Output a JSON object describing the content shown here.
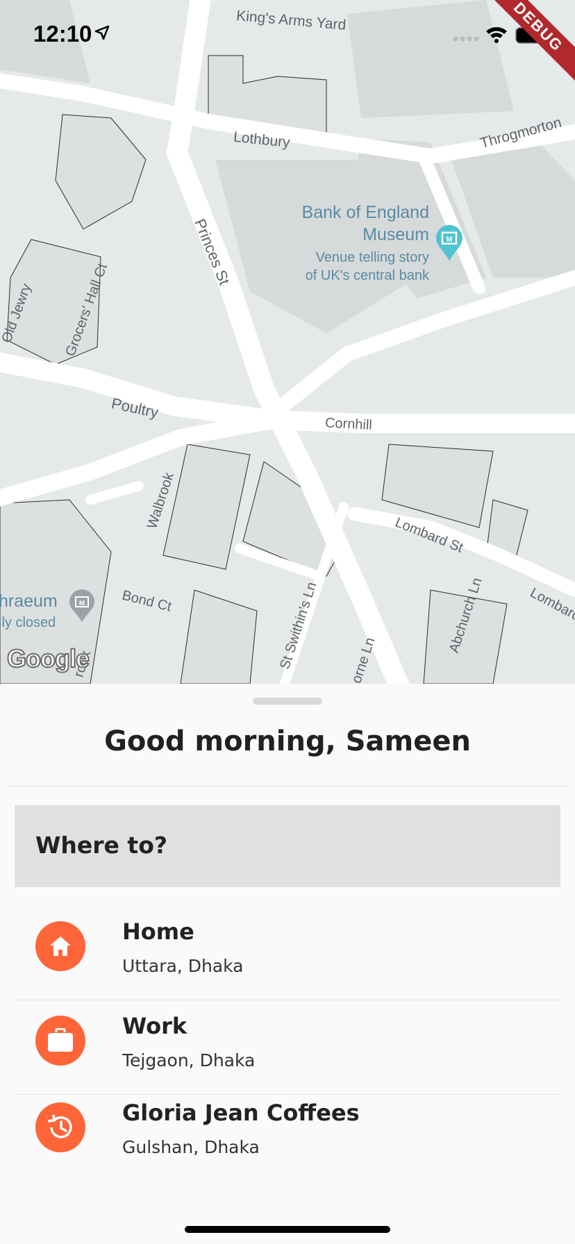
{
  "status_bar": {
    "time": "12:10",
    "debug_label": "DEBUG"
  },
  "map": {
    "street_labels": {
      "kings_arms_yard": "King's Arms Yard",
      "lothbury": "Lothbury",
      "throgmorton": "Throgmorton",
      "princes_st": "Princes St",
      "old_jewry": "Old Jewry",
      "grocers_hall_ct": "Grocers' Hall Ct",
      "poultry": "Poultry",
      "cornhill": "Cornhill",
      "walbrook": "Walbrook",
      "lombard_st": "Lombard St",
      "lombard": "Lombard",
      "bond_ct": "Bond Ct",
      "st_swithins_ln": "St Swithin's Ln",
      "abchurch_ln": "Abchurch Ln",
      "orne_ln": "orne Ln",
      "rook": "rook"
    },
    "poi": {
      "name_line1": "Bank of England",
      "name_line2": "Museum",
      "desc_line1": "Venue telling story",
      "desc_line2": "of UK's central bank",
      "icon": "museum-icon",
      "color": "#4fc3d0"
    },
    "poi2": {
      "name": "hraeum",
      "desc": "ily closed",
      "icon": "museum-icon"
    },
    "attribution": "Google"
  },
  "sheet": {
    "greeting": "Good morning, Sameen",
    "search_label": "Where to?",
    "accent": "#fe6538",
    "places": [
      {
        "title": "Home",
        "subtitle": "Uttara, Dhaka",
        "icon": "home-icon"
      },
      {
        "title": "Work",
        "subtitle": "Tejgaon, Dhaka",
        "icon": "briefcase-icon"
      },
      {
        "title": "Gloria Jean Coffees",
        "subtitle": "Gulshan, Dhaka",
        "icon": "history-icon"
      }
    ]
  }
}
